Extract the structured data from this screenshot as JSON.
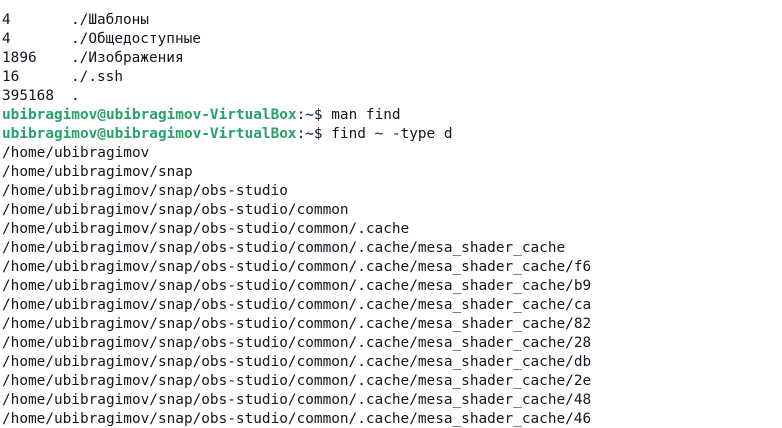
{
  "du_output": [
    {
      "size": "4",
      "path": "./Шаблоны"
    },
    {
      "size": "4",
      "path": "./Общедоступные"
    },
    {
      "size": "1896",
      "path": "./Изображения"
    },
    {
      "size": "16",
      "path": "./.ssh"
    },
    {
      "size": "395168",
      "path": "."
    }
  ],
  "prompts": [
    {
      "user_host": "ubibragimov@ubibragimov-VirtualBox",
      "colon": ":",
      "path": "~",
      "symbol": "$ ",
      "command": "man find"
    },
    {
      "user_host": "ubibragimov@ubibragimov-VirtualBox",
      "colon": ":",
      "path": "~",
      "symbol": "$ ",
      "command": "find ~ -type d"
    }
  ],
  "find_output": [
    "/home/ubibragimov",
    "/home/ubibragimov/snap",
    "/home/ubibragimov/snap/obs-studio",
    "/home/ubibragimov/snap/obs-studio/common",
    "/home/ubibragimov/snap/obs-studio/common/.cache",
    "/home/ubibragimov/snap/obs-studio/common/.cache/mesa_shader_cache",
    "/home/ubibragimov/snap/obs-studio/common/.cache/mesa_shader_cache/f6",
    "/home/ubibragimov/snap/obs-studio/common/.cache/mesa_shader_cache/b9",
    "/home/ubibragimov/snap/obs-studio/common/.cache/mesa_shader_cache/ca",
    "/home/ubibragimov/snap/obs-studio/common/.cache/mesa_shader_cache/82",
    "/home/ubibragimov/snap/obs-studio/common/.cache/mesa_shader_cache/28",
    "/home/ubibragimov/snap/obs-studio/common/.cache/mesa_shader_cache/db",
    "/home/ubibragimov/snap/obs-studio/common/.cache/mesa_shader_cache/2e",
    "/home/ubibragimov/snap/obs-studio/common/.cache/mesa_shader_cache/48",
    "/home/ubibragimov/snap/obs-studio/common/.cache/mesa_shader_cache/46"
  ],
  "colors": {
    "background": "#ffffff",
    "text": "#171421",
    "prompt_user": "#26a269",
    "prompt_path": "#12488b"
  }
}
